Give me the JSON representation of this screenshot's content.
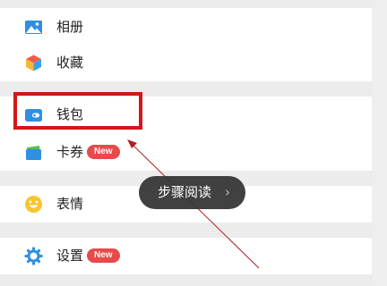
{
  "menu": {
    "album_label": "相册",
    "favorites_label": "收藏",
    "wallet_label": "钱包",
    "cards_label": "卡券",
    "cards_badge": "New",
    "stickers_label": "表情",
    "settings_label": "设置",
    "settings_badge": "New"
  },
  "reader_pill": {
    "label": "步骤阅读",
    "chevron": "›"
  },
  "colors": {
    "highlight": "#d01818",
    "badge": "#e84a4a",
    "arrow": "#b02020"
  },
  "icons": {
    "album": "image-icon",
    "favorites": "cube-icon",
    "wallet": "wallet-icon",
    "cards": "card-icon",
    "stickers": "smiley-icon",
    "settings": "gear-icon"
  }
}
